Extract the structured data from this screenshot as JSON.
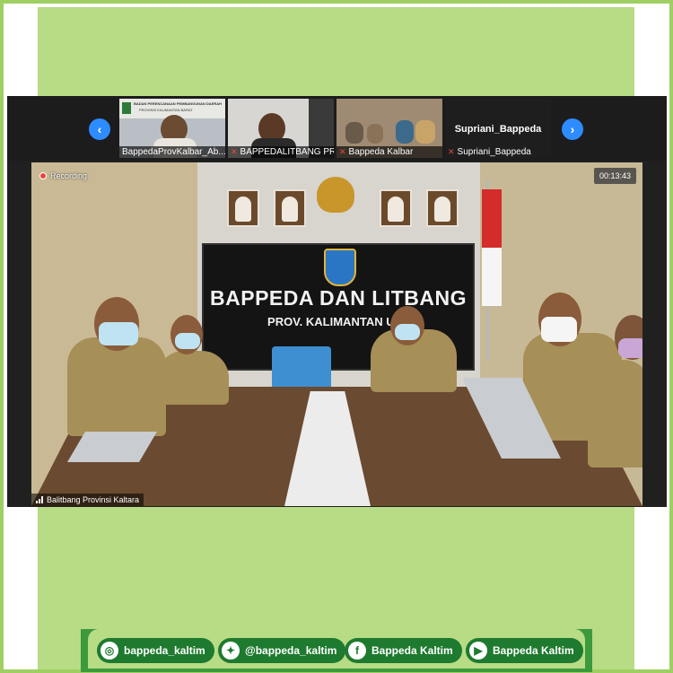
{
  "thumbnails": [
    {
      "name": "BappedaProvKalbar_Ab...",
      "muted": false,
      "banner_line1": "BADAN PERENCANAAN PEMBANGUNAN DAERAH",
      "banner_line2": "PROVINSI KALIMANTAN BARAT"
    },
    {
      "name": "BAPPEDALITBANG PR...",
      "muted": true
    },
    {
      "name": "Bappeda Kalbar",
      "muted": true
    },
    {
      "name": "Supriani_Bappeda",
      "muted": true,
      "title": "Supriani_Bappeda"
    }
  ],
  "main_video": {
    "recording_label": "Recording",
    "timer": "00:13:43",
    "participant_name": "Balitbang Provinsi Kaltara",
    "banner_line1": "BAPPEDA DAN LITBANG",
    "banner_line2": "PROV. KALIMANTAN UTA"
  },
  "social": [
    {
      "icon": "instagram-icon",
      "label": "bappeda_kaltim"
    },
    {
      "icon": "twitter-icon",
      "label": "@bappeda_kaltim"
    },
    {
      "icon": "facebook-icon",
      "label": "Bappeda Kaltim"
    },
    {
      "icon": "youtube-icon",
      "label": "Bappeda Kaltim"
    }
  ],
  "colors": {
    "frame_green": "#9fcf63",
    "inner_green": "#b7dc85",
    "pill_green": "#1e7a2e",
    "zoom_blue": "#2d8cff",
    "recording_red": "#e5483c"
  }
}
